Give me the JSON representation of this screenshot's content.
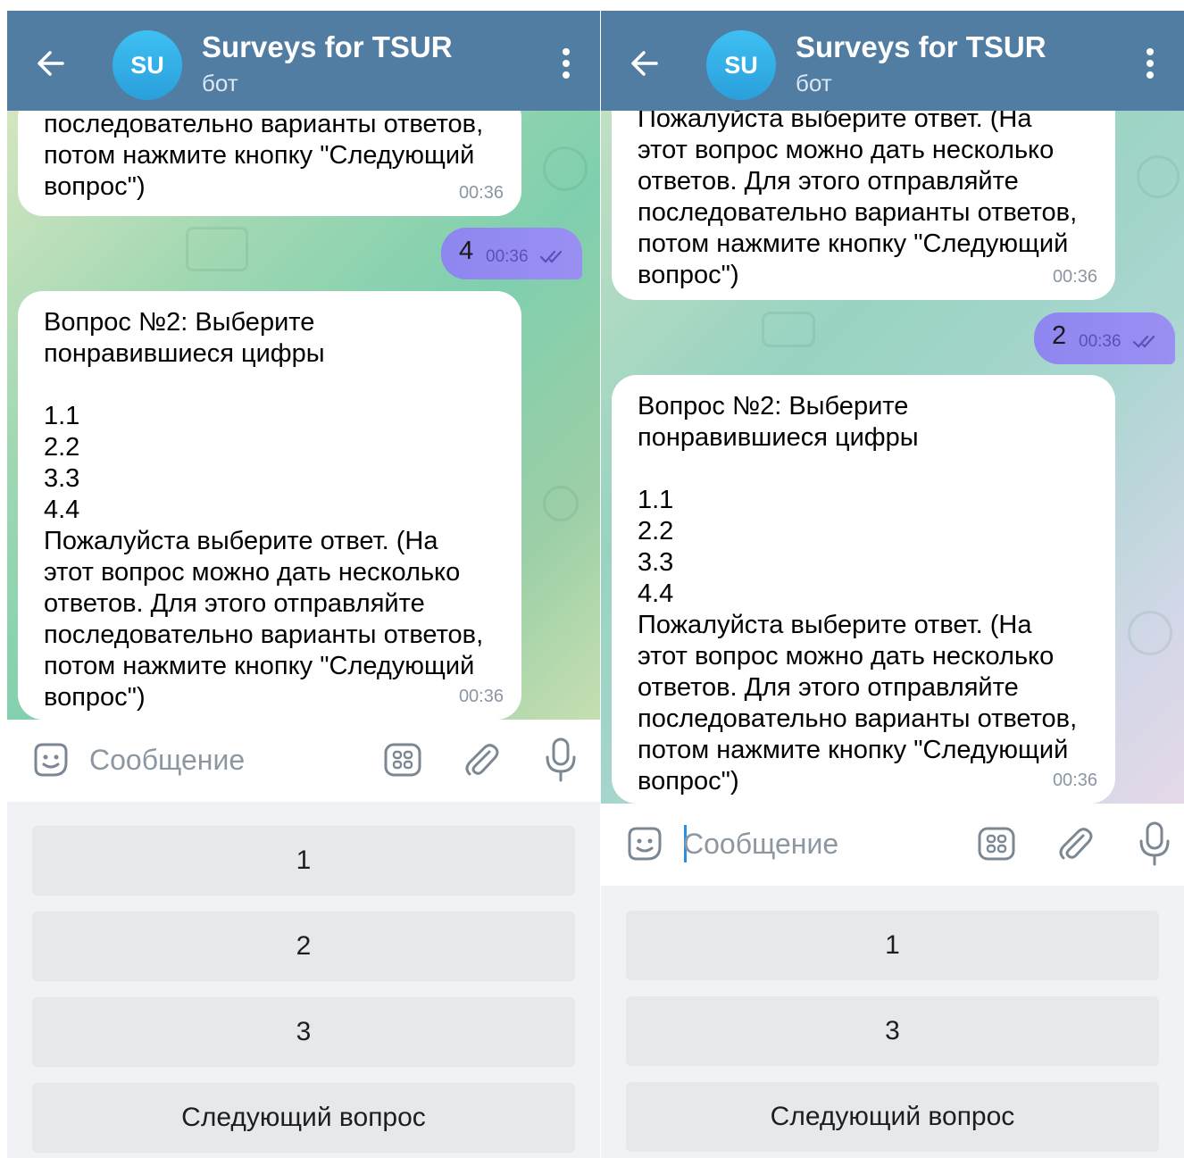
{
  "colors": {
    "header": "#527da3",
    "outgoing_bubble": "#9a8ff2",
    "reply_button": "#e6e8eb"
  },
  "left": {
    "header": {
      "avatar_initials": "SU",
      "title": "Surveys for TSUR",
      "subtitle": "бот"
    },
    "messages": [
      {
        "type": "incoming",
        "text": "последовательно варианты ответов,\nпотом нажмите кнопку \"Следующий\nвопрос\")",
        "time": "00:36"
      },
      {
        "type": "outgoing",
        "text": "4",
        "time": "00:36"
      },
      {
        "type": "incoming",
        "text": "Вопрос №2: Выберите\nпонравившиеся цифры\n\n1.1\n2.2\n3.3\n4.4\nПожалуйста выберите ответ. (На\nэтот вопрос можно дать несколько\nответов. Для этого отправляйте\nпоследовательно варианты ответов,\nпотом нажмите кнопку \"Следующий\nвопрос\")",
        "time": "00:36"
      }
    ],
    "input": {
      "placeholder": "Сообщение"
    },
    "reply_buttons": [
      "1",
      "2",
      "3",
      "Следующий вопрос"
    ]
  },
  "right": {
    "header": {
      "avatar_initials": "SU",
      "title": "Surveys for TSUR",
      "subtitle": "бот"
    },
    "messages": [
      {
        "type": "incoming",
        "text": "Пожалуйста выберите ответ. (На\nэтот вопрос можно дать несколько\nответов. Для этого отправляйте\nпоследовательно варианты ответов,\nпотом нажмите кнопку \"Следующий\nвопрос\")",
        "time": "00:36"
      },
      {
        "type": "outgoing",
        "text": "2",
        "time": "00:36"
      },
      {
        "type": "incoming",
        "text": "Вопрос №2: Выберите\nпонравившиеся цифры\n\n1.1\n2.2\n3.3\n4.4\nПожалуйста выберите ответ. (На\nэтот вопрос можно дать несколько\nответов. Для этого отправляйте\nпоследовательно варианты ответов,\nпотом нажмите кнопку \"Следующий\nвопрос\")",
        "time": "00:36"
      }
    ],
    "input": {
      "placeholder": "Сообщение"
    },
    "reply_buttons": [
      "1",
      "3",
      "Следующий вопрос"
    ]
  }
}
